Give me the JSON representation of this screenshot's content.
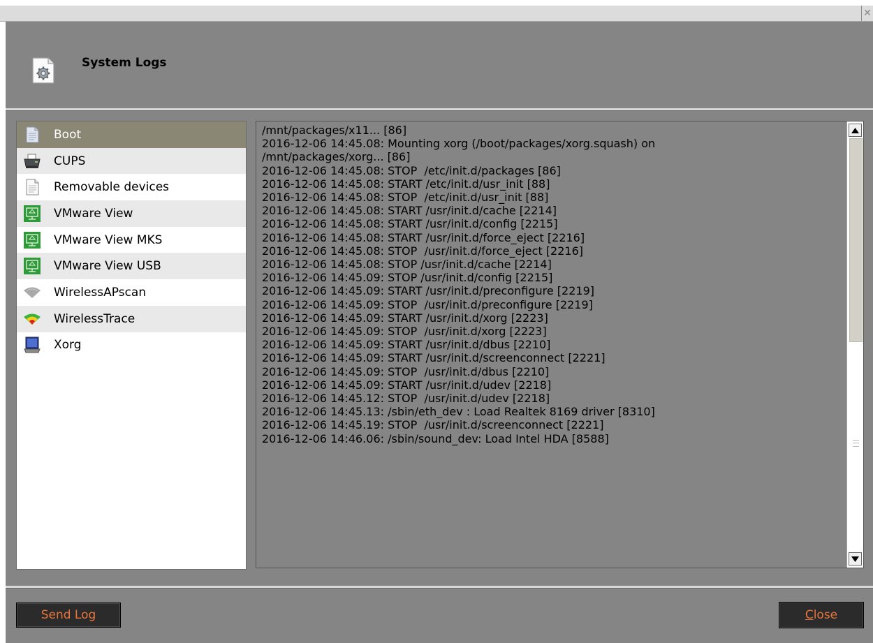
{
  "window": {
    "title": "System Logs",
    "close_glyph": "✕"
  },
  "sidebar": {
    "selected_index": 0,
    "items": [
      {
        "label": "Boot",
        "icon": "document-icon"
      },
      {
        "label": "CUPS",
        "icon": "printer-icon"
      },
      {
        "label": "Removable devices",
        "icon": "document-icon"
      },
      {
        "label": "VMware View",
        "icon": "vmware-icon"
      },
      {
        "label": "VMware View MKS",
        "icon": "vmware-icon"
      },
      {
        "label": "VMware View USB",
        "icon": "vmware-icon"
      },
      {
        "label": "WirelessAPscan",
        "icon": "wireless-gray-icon"
      },
      {
        "label": "WirelessTrace",
        "icon": "wireless-color-icon"
      },
      {
        "label": "Xorg",
        "icon": "monitor-icon"
      }
    ]
  },
  "log": {
    "lines": [
      "/mnt/packages/x11... [86]",
      "2016-12-06 14:45.08: Mounting xorg (/boot/packages/xorg.squash) on",
      "/mnt/packages/xorg... [86]",
      "2016-12-06 14:45.08: STOP  /etc/init.d/packages [86]",
      "2016-12-06 14:45.08: START /etc/init.d/usr_init [88]",
      "2016-12-06 14:45.08: STOP  /etc/init.d/usr_init [88]",
      "2016-12-06 14:45.08: START /usr/init.d/cache [2214]",
      "2016-12-06 14:45.08: START /usr/init.d/config [2215]",
      "2016-12-06 14:45.08: START /usr/init.d/force_eject [2216]",
      "2016-12-06 14:45.08: STOP  /usr/init.d/force_eject [2216]",
      "2016-12-06 14:45.08: STOP /usr/init.d/cache [2214]",
      "2016-12-06 14:45.09: STOP /usr/init.d/config [2215]",
      "2016-12-06 14:45.09: START /usr/init.d/preconfigure [2219]",
      "2016-12-06 14:45.09: STOP  /usr/init.d/preconfigure [2219]",
      "2016-12-06 14:45.09: START /usr/init.d/xorg [2223]",
      "2016-12-06 14:45.09: STOP  /usr/init.d/xorg [2223]",
      "2016-12-06 14:45.09: START /usr/init.d/dbus [2210]",
      "2016-12-06 14:45.09: START /usr/init.d/screenconnect [2221]",
      "2016-12-06 14:45.09: STOP  /usr/init.d/dbus [2210]",
      "2016-12-06 14:45.09: START /usr/init.d/udev [2218]",
      "2016-12-06 14:45.12: STOP  /usr/init.d/udev [2218]",
      "2016-12-06 14:45.13: /sbin/eth_dev : Load Realtek 8169 driver [8310]",
      "2016-12-06 14:45.19: STOP  /usr/init.d/screenconnect [2221]",
      "2016-12-06 14:46.06: /sbin/sound_dev: Load Intel HDA [8588]"
    ]
  },
  "buttons": {
    "send_log": "Send Log",
    "close_first": "C",
    "close_rest": "lose"
  },
  "colors": {
    "background": "#858585",
    "selected_row": "#8b8775",
    "button_text": "#e8743b"
  }
}
